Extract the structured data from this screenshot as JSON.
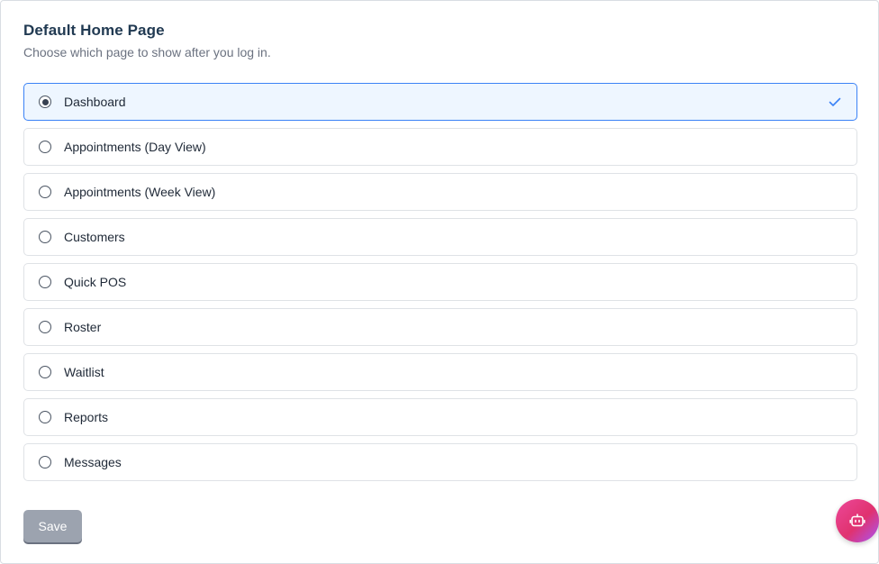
{
  "header": {
    "title": "Default Home Page",
    "subtitle": "Choose which page to show after you log in."
  },
  "options": [
    {
      "label": "Dashboard",
      "selected": true
    },
    {
      "label": "Appointments (Day View)",
      "selected": false
    },
    {
      "label": "Appointments (Week View)",
      "selected": false
    },
    {
      "label": "Customers",
      "selected": false
    },
    {
      "label": "Quick POS",
      "selected": false
    },
    {
      "label": "Roster",
      "selected": false
    },
    {
      "label": "Waitlist",
      "selected": false
    },
    {
      "label": "Reports",
      "selected": false
    },
    {
      "label": "Messages",
      "selected": false
    }
  ],
  "actions": {
    "save_label": "Save"
  },
  "colors": {
    "selected_border": "#3b82f6",
    "selected_bg": "#eef6ff",
    "check_color": "#3b82f6",
    "save_disabled": "#9ca3af",
    "fab_gradient_start": "#ec4899",
    "fab_gradient_end": "#a855f7"
  },
  "icons": {
    "selected_check": "check-icon",
    "assistant": "robot-icon"
  }
}
